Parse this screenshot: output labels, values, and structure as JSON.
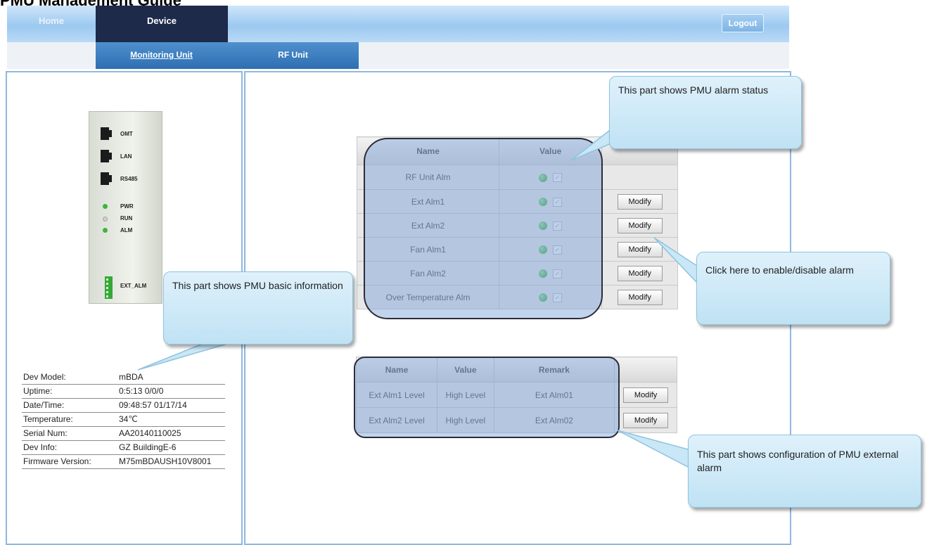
{
  "doc_title": "PMU Management Guide",
  "nav": {
    "home": "Home",
    "device": "Device",
    "logout": "Logout"
  },
  "subnav": {
    "monitoring_unit": "Monitoring Unit",
    "rf_unit": "RF Unit"
  },
  "device_panel": {
    "ports": [
      "OMT",
      "LAN",
      "RS485"
    ],
    "leds": [
      "PWR",
      "RUN",
      "ALM"
    ],
    "ext_alm": "EXT_ALM"
  },
  "basic_info": [
    {
      "label": "Dev Model:",
      "value": "mBDA"
    },
    {
      "label": "Uptime:",
      "value": "0:5:13 0/0/0"
    },
    {
      "label": "Date/Time:",
      "value": "09:48:57 01/17/14"
    },
    {
      "label": "Temperature:",
      "value": "34℃"
    },
    {
      "label": "Serial Num:",
      "value": "AA20140110025"
    },
    {
      "label": "Dev Info:",
      "value": "GZ BuildingE-6"
    },
    {
      "label": "Firmware Version:",
      "value": "M75mBDAUSH10V8001"
    }
  ],
  "alarm_table": {
    "headers": {
      "name": "Name",
      "value": "Value"
    },
    "rows": [
      {
        "name": "RF Unit Alm"
      },
      {
        "name": "Ext Alm1",
        "action": "Modify"
      },
      {
        "name": "Ext Alm2",
        "action": "Modify"
      },
      {
        "name": "Fan Alm1",
        "action": "Modify"
      },
      {
        "name": "Fan Alm2",
        "action": "Modify"
      },
      {
        "name": "Over Temperature Alm",
        "action": "Modify"
      }
    ]
  },
  "ext_table": {
    "headers": {
      "name": "Name",
      "value": "Value",
      "remark": "Remark"
    },
    "rows": [
      {
        "name": "Ext Alm1 Level",
        "value": "High Level",
        "remark": "Ext Alm01",
        "action": "Modify"
      },
      {
        "name": "Ext Alm2 Level",
        "value": "High Level",
        "remark": "Ext Alm02",
        "action": "Modify"
      }
    ]
  },
  "callouts": {
    "alarm_status": "This part shows PMU alarm status",
    "enable_disable": "Click here to enable/disable alarm",
    "basic_info": "This part shows PMU basic information",
    "ext_config": "This part shows configuration of PMU external alarm"
  },
  "colors": {
    "nav_active": "#1e2a4a",
    "subnav": "#2d6fb2",
    "highlight": "#78a0d7",
    "led_green": "#3cb43c"
  }
}
